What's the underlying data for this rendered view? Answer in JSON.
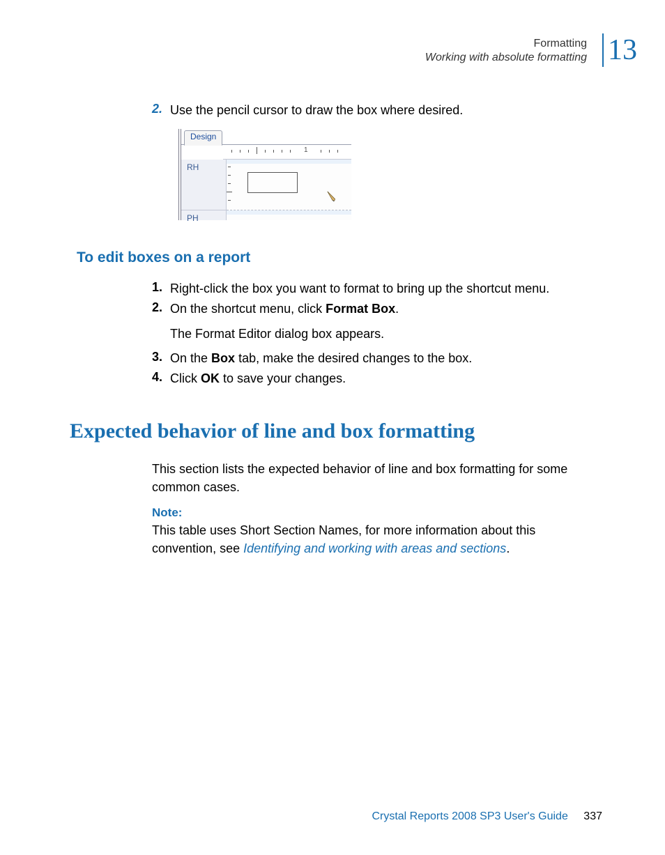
{
  "header": {
    "breadcrumb_top": "Formatting",
    "breadcrumb_sub": "Working with absolute formatting",
    "chapter_number": "13"
  },
  "intro_step": {
    "number": "2.",
    "text": "Use the pencil cursor to draw the box where desired."
  },
  "design_mock": {
    "tab_label": "Design",
    "section_rh": "RH",
    "section_ph": "PH"
  },
  "sections": {
    "edit_title": "To edit boxes on a report",
    "steps": [
      {
        "num": "1.",
        "text": "Right-click the box you want to format to bring up the shortcut menu."
      },
      {
        "num": "2.",
        "prefix": "On the shortcut menu, click ",
        "bold": "Format Box",
        "suffix": "."
      },
      {
        "num": "3.",
        "prefix": "On the ",
        "bold": "Box",
        "suffix": " tab, make the desired changes to the box."
      },
      {
        "num": "4.",
        "prefix": "Click ",
        "bold": "OK",
        "suffix": " to save your changes."
      }
    ],
    "step2_subtext": "The Format Editor dialog box appears."
  },
  "behavior": {
    "title": "Expected behavior of line and box formatting",
    "intro": "This section lists the expected behavior of line and box formatting for some common cases.",
    "note_label": "Note:",
    "note_prefix": "This table uses Short Section Names, for more information about this convention, see ",
    "note_link": "Identifying and working with areas and sections",
    "note_suffix": "."
  },
  "footer": {
    "guide": "Crystal Reports 2008 SP3 User's Guide",
    "page": "337"
  }
}
